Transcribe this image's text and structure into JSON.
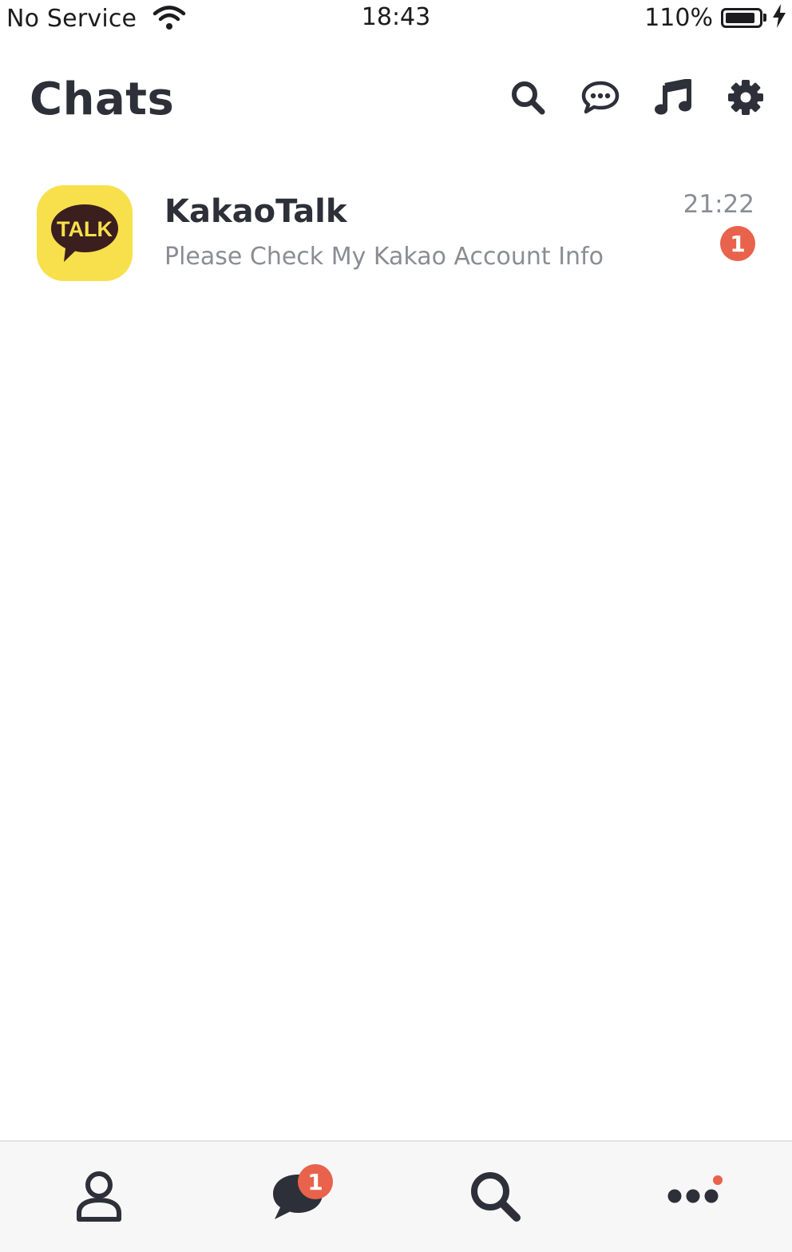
{
  "status_bar": {
    "carrier": "No Service",
    "time": "18:43",
    "battery_percent": "110%",
    "battery_level": 0.9,
    "charging": true,
    "icons": [
      "wifi-icon",
      "battery-icon",
      "charging-bolt-icon"
    ]
  },
  "header": {
    "title": "Chats",
    "actions": [
      "search-icon",
      "new-chat-icon",
      "music-icon",
      "settings-icon"
    ]
  },
  "chats": [
    {
      "name": "KakaoTalk",
      "avatar_label": "TALK",
      "preview": "Please Check My Kakao Account Info",
      "time": "21:22",
      "unread": "1"
    }
  ],
  "bottom_nav": {
    "items": [
      {
        "icon": "friends-icon"
      },
      {
        "icon": "chats-icon",
        "badge": "1"
      },
      {
        "icon": "search-icon"
      },
      {
        "icon": "more-icon",
        "dot": true
      }
    ]
  },
  "colors": {
    "badge": "#e8624c",
    "kakao_yellow": "#f7e04b",
    "kakao_brown": "#3b1e1e",
    "icon_dark": "#2d3038",
    "secondary_text": "#8a8d93"
  }
}
